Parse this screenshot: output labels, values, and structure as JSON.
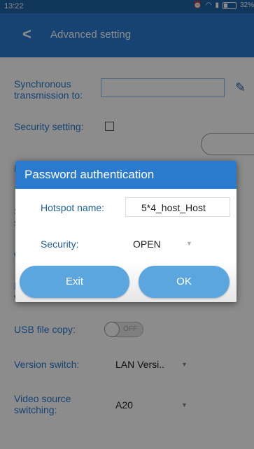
{
  "status_bar": {
    "time": "13:22",
    "battery": "32%"
  },
  "app_bar": {
    "back_icon": "chevron-left-icon",
    "title": "Advanced setting"
  },
  "settings": {
    "sync_label": "Synchronous transmission to:",
    "sync_value": "",
    "security_label": "Security setting:",
    "row3_label_partial": "Re",
    "row4_label_partial": "Si",
    "row4_label_partial2": "sc",
    "row5_label_partial": "W",
    "row6_label_partial": "Do",
    "row6_label_partial2": "ve",
    "usb_label": "USB file copy:",
    "usb_toggle": "OFF",
    "version_label": "Version switch:",
    "version_value": "LAN Versi..",
    "video_label": "Video source switching:",
    "video_value": "A20"
  },
  "dialog": {
    "title": "Password authentication",
    "hotspot_label": "Hotspot name:",
    "hotspot_value": "5*4_host_Host",
    "security_label": "Security:",
    "security_value": "OPEN",
    "exit_label": "Exit",
    "ok_label": "OK"
  },
  "colors": {
    "accent": "#2a7ad0",
    "status_bar": "#1f63a6",
    "button": "#5ba6df"
  }
}
